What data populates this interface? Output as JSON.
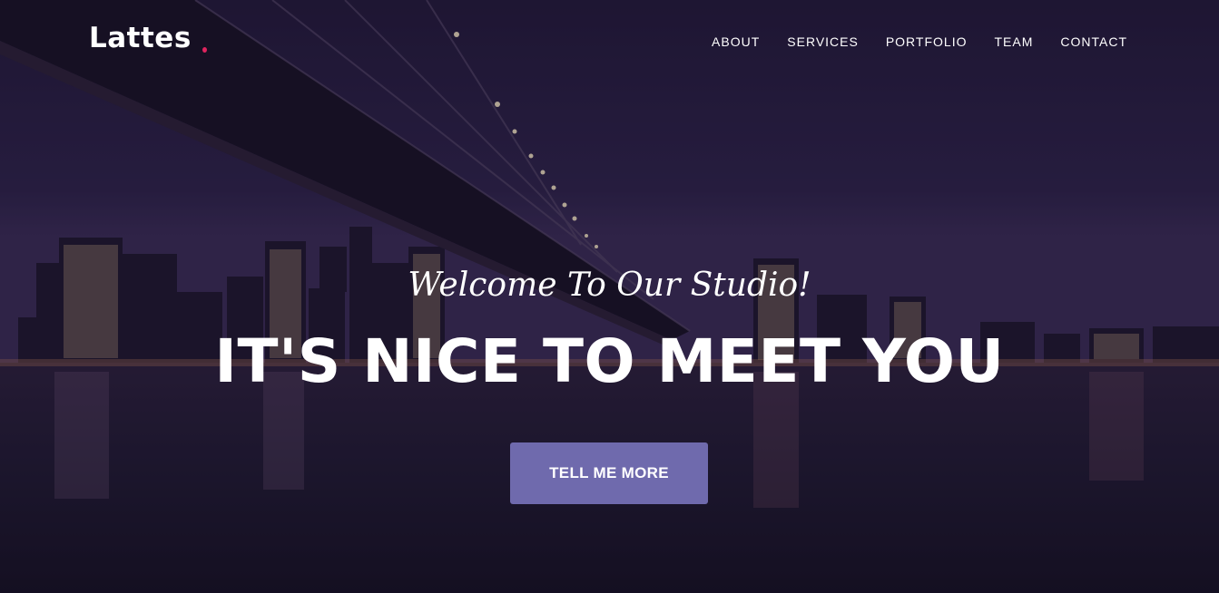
{
  "brand": {
    "name": "Lattes",
    "dot_color": "#e0245e"
  },
  "nav": {
    "items": [
      {
        "label": "ABOUT"
      },
      {
        "label": "SERVICES"
      },
      {
        "label": "PORTFOLIO"
      },
      {
        "label": "TEAM"
      },
      {
        "label": "CONTACT"
      }
    ]
  },
  "hero": {
    "subheading": "Welcome To Our Studio!",
    "heading": "IT'S NICE TO MEET YOU",
    "cta_label": "TELL ME MORE",
    "cta_color": "#6f6aad",
    "background": "night city skyline under bridge"
  }
}
